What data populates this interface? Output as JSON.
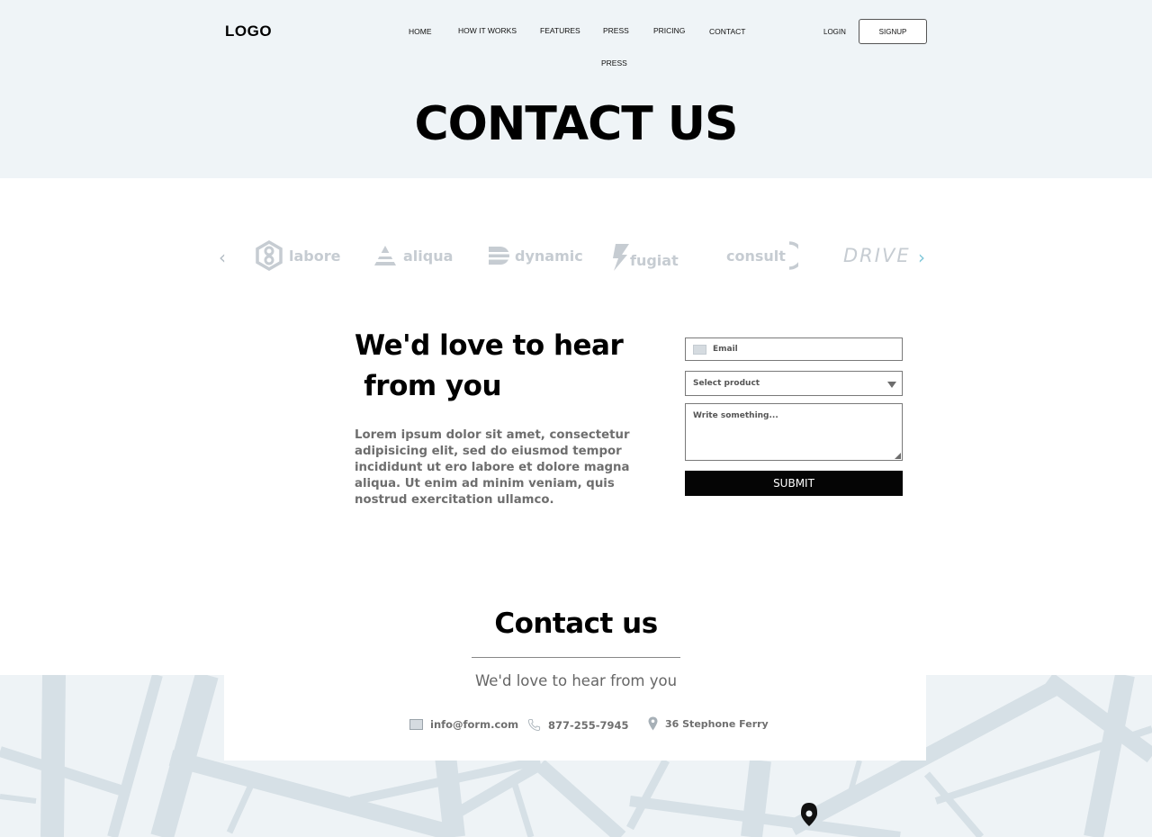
{
  "header": {
    "logo": "LOGO",
    "nav": [
      "HOME",
      "HOW IT WORKS",
      "FEATURES",
      "PRESS",
      "PRICING",
      "CONTACT"
    ],
    "nav_overflow": "PRESS",
    "login": "LOGIN",
    "signup": "SIGNUP",
    "page_title": "CONTACT US"
  },
  "brands": {
    "items": [
      "labore",
      "aliqua",
      "dynamic",
      "fugiat",
      "consult",
      "DRIVE"
    ],
    "prev_icon": "chevron-left-icon",
    "next_icon": "chevron-right-icon",
    "arrow_colors": {
      "prev": "#b3bcc4",
      "next": "#7fc7d9"
    },
    "logo_color": "#c6ccd2"
  },
  "intro": {
    "headline": "We'd love to hear\n from you",
    "body": "Lorem ipsum dolor sit amet, consectetur adipisicing elit, sed do eiusmod tempor incididunt ut ero labore et dolore magna aliqua. Ut enim ad minim veniam, quis nostrud exercitation ullamco."
  },
  "form": {
    "email_placeholder": "Email",
    "select_value": "Select product",
    "message_placeholder": "Write something...",
    "submit": "SUBMIT"
  },
  "contact": {
    "title": "Contact us",
    "subtitle": "We'd love to hear from you",
    "email": "info@form.com",
    "phone": "877-255-7945",
    "address": "36 Stephone Ferry"
  },
  "colors": {
    "hero_bg": "#eff4f7",
    "map_bg": "#eef3f6",
    "map_roads": "#d6e0e6",
    "submit_bg": "#050505",
    "muted_text": "#6e6e6e"
  }
}
